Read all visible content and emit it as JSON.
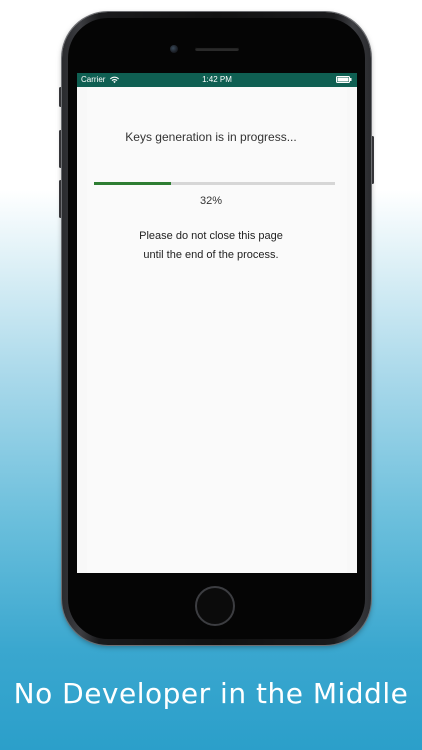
{
  "status_bar": {
    "carrier": "Carrier",
    "time": "1:42 PM",
    "wifi_icon": "wifi-icon",
    "battery_icon": "battery-icon",
    "color": "#0f5f52"
  },
  "progress": {
    "title": "Keys generation is in progress...",
    "value_percent": 32,
    "label": "32%",
    "fill_color": "#2e7d32",
    "track_color": "#d6d6d6"
  },
  "notice": {
    "line1": "Please do not close this page",
    "line2": "until the end of the process."
  },
  "tagline": "No Developer in the Middle"
}
